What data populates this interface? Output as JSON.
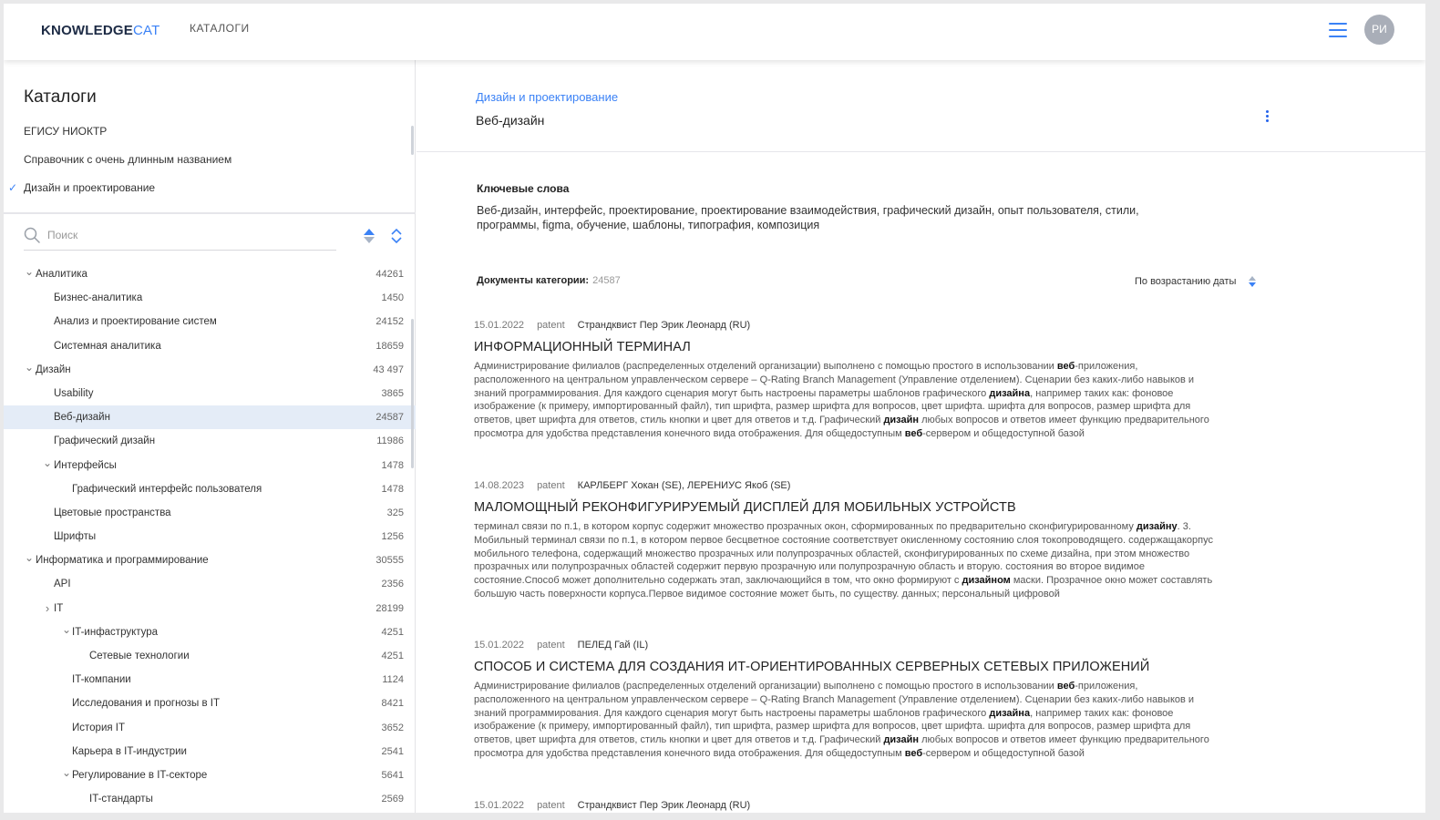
{
  "header": {
    "logo_bold": "KNOWLEDGE",
    "logo_light": "CAT",
    "nav_catalogs": "КАТАЛОГИ",
    "avatar_initials": "РИ",
    "accent_color": "#3b82f6"
  },
  "sidebar": {
    "title": "Каталоги",
    "catalogs": [
      {
        "label": "ЕГИСУ НИОКТР",
        "selected": false
      },
      {
        "label": "Справочник с очень длинным названием",
        "selected": false
      },
      {
        "label": "Дизайн и проектирование",
        "selected": true
      }
    ],
    "search": {
      "placeholder": "Поиск",
      "value": ""
    },
    "tree": [
      {
        "label": "Аналитика",
        "count": "44261",
        "level": 0,
        "chevron": "open"
      },
      {
        "label": "Бизнес-аналитика",
        "count": "1450",
        "level": 1,
        "chevron": "none"
      },
      {
        "label": "Анализ и проектирование систем",
        "count": "24152",
        "level": 1,
        "chevron": "none"
      },
      {
        "label": "Системная аналитика",
        "count": "18659",
        "level": 1,
        "chevron": "none"
      },
      {
        "label": "Дизайн",
        "count": "43 497",
        "level": 0,
        "chevron": "open"
      },
      {
        "label": "Usability",
        "count": "3865",
        "level": 1,
        "chevron": "none"
      },
      {
        "label": "Веб-дизайн",
        "count": "24587",
        "level": 1,
        "chevron": "none",
        "active": true
      },
      {
        "label": "Графический дизайн",
        "count": "11986",
        "level": 1,
        "chevron": "none"
      },
      {
        "label": "Интерфейсы",
        "count": "1478",
        "level": 1,
        "chevron": "open"
      },
      {
        "label": "Графический интерфейс пользователя",
        "count": "1478",
        "level": 2,
        "chevron": "none"
      },
      {
        "label": "Цветовые пространства",
        "count": "325",
        "level": 1,
        "chevron": "none"
      },
      {
        "label": "Шрифты",
        "count": "1256",
        "level": 1,
        "chevron": "none"
      },
      {
        "label": "Информатика и программирование",
        "count": "30555",
        "level": 0,
        "chevron": "open"
      },
      {
        "label": "API",
        "count": "2356",
        "level": 1,
        "chevron": "none"
      },
      {
        "label": "IT",
        "count": "28199",
        "level": 1,
        "chevron": "closed"
      },
      {
        "label": "IT-инфаструктура",
        "count": "4251",
        "level": 2,
        "chevron": "open"
      },
      {
        "label": "Сетевые технологии",
        "count": "4251",
        "level": 3,
        "chevron": "none"
      },
      {
        "label": "IT-компании",
        "count": "1124",
        "level": 2,
        "chevron": "none"
      },
      {
        "label": "Исследования и прогнозы в IT",
        "count": "8421",
        "level": 2,
        "chevron": "none"
      },
      {
        "label": "История IT",
        "count": "3652",
        "level": 2,
        "chevron": "none"
      },
      {
        "label": "Карьера в IT-индустрии",
        "count": "2541",
        "level": 2,
        "chevron": "none"
      },
      {
        "label": "Регулирование в IT-секторе",
        "count": "5641",
        "level": 2,
        "chevron": "open"
      },
      {
        "label": "IT-стандарты",
        "count": "2569",
        "level": 3,
        "chevron": "none"
      }
    ]
  },
  "main": {
    "breadcrumb": "Дизайн и проектирование",
    "title": "Веб-дизайн",
    "keywords_title": "Ключевые слова",
    "keywords_text": "Веб-дизайн, интерфейс, проектирование, проектирование взаимодействия, графический дизайн, опыт пользователя, стили, программы, figma, обучение, шаблоны, типография, композиция",
    "docs_label": "Документы категории:",
    "docs_count": "24587",
    "sort_label": "По возрастанию даты",
    "documents": [
      {
        "date": "15.01.2022",
        "type": "patent",
        "authors": "Страндквист Пер Эрик Леонард (RU)",
        "title": "ИНФОРМАЦИОННЫЙ ТЕРМИНАЛ",
        "abstract": "Администрирование филиалов (распределенных отделений организации) выполнено с помощью простого в использовании **веб**-приложения, расположенного на центральном управленческом сервере – Q-Rating Branch Management (Управление отделением). Сценарии без каких-либо навыков и знаний программирования. Для каждого сценария могут быть настроены параметры шаблонов графического **дизайна**, например таких как: фоновое изображение (к примеру, импортированный файл), тип шрифта, размер шрифта для вопросов, цвет шрифта. шрифта для вопросов, размер шрифта для ответов, цвет шрифта для ответов, стиль кнопки и цвет для ответов и т.д. Графический **дизайн** любых вопросов и ответов имеет функцию предварительного просмотра для удобства представления конечного вида отображения. Для общедоступным **веб**-сервером и общедоступной базой"
      },
      {
        "date": "14.08.2023",
        "type": "patent",
        "authors": "КАРЛБЕРГ Хокан (SE), ЛЕРЕНИУС Якоб (SE)",
        "title": "МАЛОМОЩНЫЙ РЕКОНФИГУРИРУЕМЫЙ ДИСПЛЕЙ ДЛЯ МОБИЛЬНЫХ УСТРОЙСТВ",
        "abstract": "терминал связи по п.1, в котором корпус содержит множество прозрачных окон, сформированных по предварительно сконфигурированному **дизайну**. 3. Мобильный терминал связи по п.1, в котором первое бесцветное состояние соответствует окисленному состоянию слоя токопроводящего. содержащакорпус мобильного телефона, содержащий множество прозрачных или полупрозрачных областей, сконфигурированных по схеме дизайна, при этом множество прозрачных или полупрозрачных областей содержит первую прозрачную или полупрозрачную область и вторую. состояния во второе видимое состояние.Способ может дополнительно содержать этап, заключающийся в том, что окно формируют с **дизайном** маски. Прозрачное окно может составлять большую часть поверхности корпуса.Первое видимое состояние может быть, по существу. данных; персональный цифровой"
      },
      {
        "date": "15.01.2022",
        "type": "patent",
        "authors": "ПЕЛЕД Гай (IL)",
        "title": "СПОСОБ И СИСТЕМА ДЛЯ СОЗДАНИЯ ИТ-ОРИЕНТИРОВАННЫХ СЕРВЕРНЫХ СЕТЕВЫХ ПРИЛОЖЕНИЙ",
        "abstract": "Администрирование филиалов (распределенных отделений организации) выполнено с помощью простого в использовании **веб**-приложения, расположенного на центральном управленческом сервере – Q-Rating Branch Management (Управление отделением). Сценарии без каких-либо навыков и знаний программирования. Для каждого сценария могут быть настроены параметры шаблонов графического **дизайна**, например таких как: фоновое изображение (к примеру, импортированный файл), тип шрифта, размер шрифта для вопросов, цвет шрифта. шрифта для вопросов, размер шрифта для ответов, цвет шрифта для ответов, стиль кнопки и цвет для ответов и т.д. Графический **дизайн** любых вопросов и ответов имеет функцию предварительного просмотра для удобства представления конечного вида отображения. Для общедоступным **веб**-сервером и общедоступной базой"
      },
      {
        "date": "15.01.2022",
        "type": "patent",
        "authors": "Страндквист Пер Эрик Леонард (RU)",
        "title": "",
        "abstract": ""
      }
    ]
  }
}
